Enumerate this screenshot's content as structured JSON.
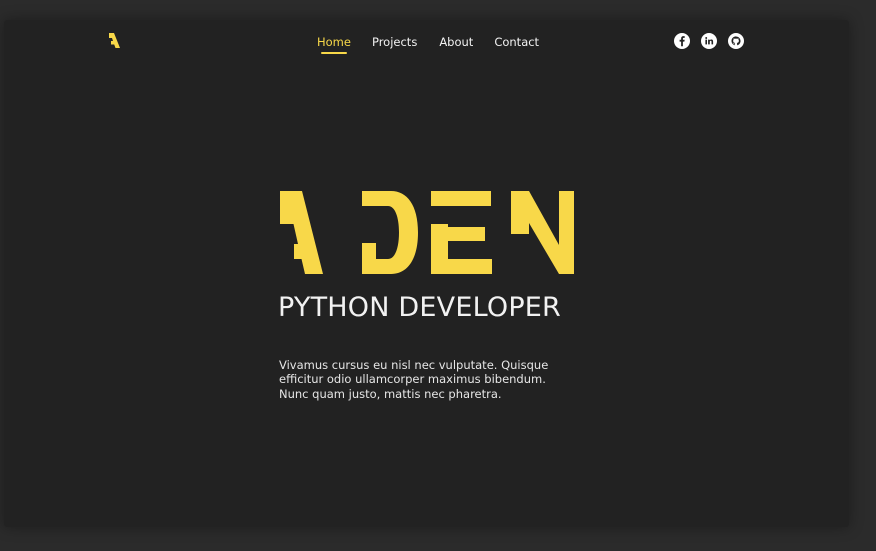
{
  "colors": {
    "accent": "#f8d849",
    "background": "#222222",
    "outer_background": "#2b2b2b",
    "text": "#f2f2f2"
  },
  "header": {
    "logo_text": "A",
    "nav": [
      {
        "label": "Home",
        "active": true
      },
      {
        "label": "Projects",
        "active": false
      },
      {
        "label": "About",
        "active": false
      },
      {
        "label": "Contact",
        "active": false
      }
    ],
    "socials": [
      {
        "icon": "facebook-icon"
      },
      {
        "icon": "linkedin-icon"
      },
      {
        "icon": "github-icon"
      }
    ]
  },
  "hero": {
    "title": "ADEN",
    "subtitle": "PYTHON DEVELOPER",
    "description": "Vivamus cursus eu nisl nec vulputate. Quisque efficitur odio ullamcorper maximus bibendum. Nunc quam justo, mattis nec pharetra."
  }
}
